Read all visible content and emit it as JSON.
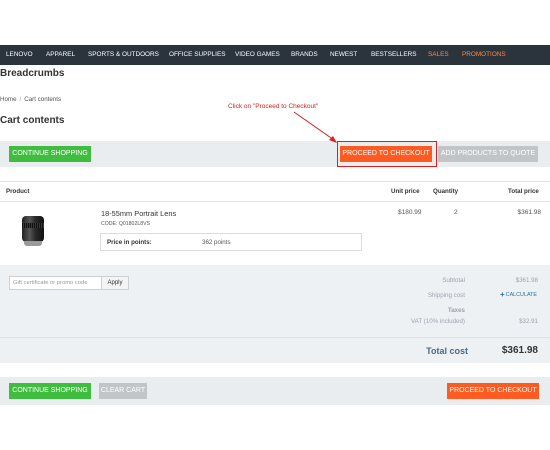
{
  "nav": {
    "items": [
      {
        "label": "Lenovo",
        "highlight": false
      },
      {
        "label": "Apparel",
        "highlight": false
      },
      {
        "label": "Sports & Outdoors",
        "highlight": false
      },
      {
        "label": "Office Supplies",
        "highlight": false
      },
      {
        "label": "Video Games",
        "highlight": false
      },
      {
        "label": "Brands",
        "highlight": false
      },
      {
        "label": "Newest",
        "highlight": false
      },
      {
        "label": "Bestsellers",
        "highlight": false
      },
      {
        "label": "Sales",
        "highlight": true
      },
      {
        "label": "Promotions",
        "highlight": true
      }
    ]
  },
  "breadcrumbs_heading": "Breadcrumbs",
  "breadcrumb": {
    "home": "Home",
    "separator": "/",
    "current": "Cart contents"
  },
  "page_title": "Cart contents",
  "annotation": {
    "text": "Click on \"Proceed to Checkout\"",
    "color": "#d82020"
  },
  "top_actions": {
    "continue_shopping": "Continue shopping",
    "proceed_to_checkout": "Proceed to checkout",
    "add_products_to_quote": "Add products to quote"
  },
  "table": {
    "headers": {
      "product": "Product",
      "unit_price": "Unit price",
      "quantity": "Quantity",
      "total_price": "Total price"
    },
    "rows": [
      {
        "name": "18-55mm Portrait Lens",
        "code": "CODE: Q01802L8VS",
        "points_label": "Price in points:",
        "points_value": "362 points",
        "unit_price": "$180.99",
        "quantity": "2",
        "total_price": "$361.98",
        "image_icon": "camera-lens-icon"
      }
    ]
  },
  "promo": {
    "placeholder": "Gift certificate or promo code",
    "apply_label": "Apply"
  },
  "summary": {
    "subtotal_label": "Subtotal",
    "subtotal_value": "$361.98",
    "shipping_label": "Shipping cost",
    "shipping_action": "Calculate",
    "taxes_label": "Taxes",
    "vat_label": "VAT (10% included)",
    "vat_value": "$32.91",
    "total_label": "Total cost",
    "total_value": "$361.98"
  },
  "bottom_actions": {
    "continue_shopping": "Continue shopping",
    "clear_cart": "Clear cart",
    "proceed_to_checkout": "Proceed to checkout"
  },
  "colors": {
    "nav_background": "#2b333d",
    "nav_highlight": "#ff8a3d",
    "checkout_button": "#ff5a1f",
    "continue_button": "#3fbd3e",
    "disabled_button": "#c2c5c8",
    "annotation": "#d82020"
  }
}
